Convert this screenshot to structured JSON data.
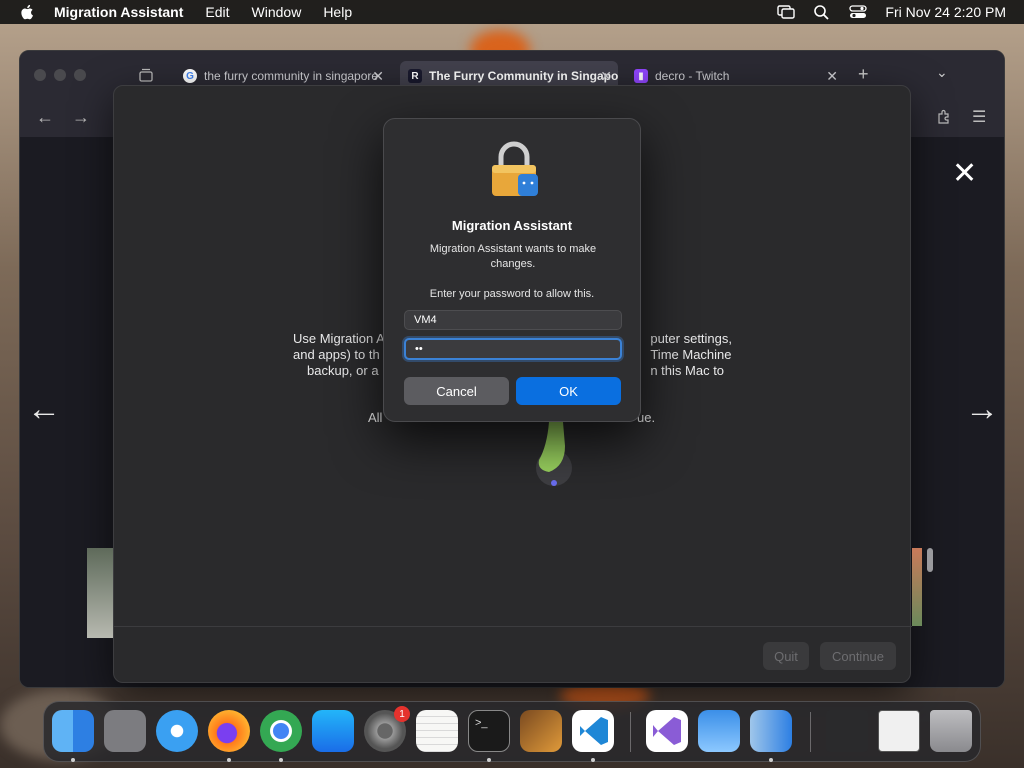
{
  "menubar": {
    "app_name": "Migration Assistant",
    "menus": [
      "Edit",
      "Window",
      "Help"
    ],
    "clock": "Fri Nov 24  2:20 PM"
  },
  "browser": {
    "tabs": [
      {
        "label": "the furry community in singapore",
        "favicon": "google-icon"
      },
      {
        "label": "The Furry Community in Singapore",
        "favicon": "reddit-style-r-icon",
        "active": true
      },
      {
        "label": "decro - Twitch",
        "favicon": "twitch-icon"
      }
    ]
  },
  "migration_window": {
    "body_left": "Use Migration Assistant to transfer information (such as computer settings, and apps) to this Mac from another Mac, a Time Machine backup, or a startup disk, or from this Mac to",
    "body_visible_lines": [
      "Use Migration A",
      "and apps) to th",
      "backup, or a"
    ],
    "body_right_lines": [
      "puter settings,",
      "Time Machine",
      "n this Mac to"
    ],
    "continue_line_left": "All",
    "continue_line_right": "ue.",
    "quit_label": "Quit",
    "continue_label": "Continue"
  },
  "dialog": {
    "title": "Migration Assistant",
    "message": "Migration Assistant wants to make changes.",
    "prompt": "Enter your password to allow this.",
    "username_value": "VM4",
    "password_mask": "••",
    "cancel_label": "Cancel",
    "ok_label": "OK",
    "accent": "#0a6fe0"
  },
  "dock": {
    "apps": [
      "finder-icon",
      "launchpad-icon",
      "safari-icon",
      "firefox-icon",
      "chrome-icon",
      "app-store-icon",
      "system-settings-icon",
      "textedit-icon",
      "terminal-icon",
      "instruments-icon",
      "vscode-icon",
      "visual-studio-icon",
      "weather-icon",
      "migration-assistant-icon",
      "window-thumbnail-1",
      "window-thumbnail-2",
      "trash-icon"
    ],
    "settings_badge": "1"
  }
}
